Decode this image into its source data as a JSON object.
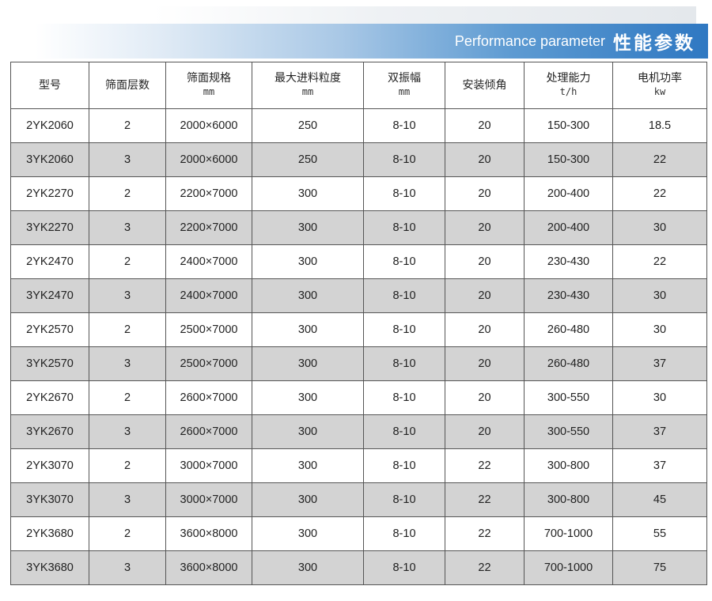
{
  "header": {
    "title_en": "Performance parameter",
    "title_cn": "性能参数"
  },
  "colors": {
    "banner_accent": "#2f78c2",
    "row_shade": "#d3d3d3",
    "border": "#555555"
  },
  "table": {
    "columns": [
      {
        "label": "型号",
        "unit": ""
      },
      {
        "label": "筛面层数",
        "unit": ""
      },
      {
        "label": "筛面规格",
        "unit": "mm"
      },
      {
        "label": "最大进料粒度",
        "unit": "mm"
      },
      {
        "label": "双振幅",
        "unit": "mm"
      },
      {
        "label": "安装倾角",
        "unit": ""
      },
      {
        "label": "处理能力",
        "unit": "t/h"
      },
      {
        "label": "电机功率",
        "unit": "kw"
      }
    ],
    "rows": [
      [
        "2YK2060",
        "2",
        "2000×6000",
        "250",
        "8-10",
        "20",
        "150-300",
        "18.5"
      ],
      [
        "3YK2060",
        "3",
        "2000×6000",
        "250",
        "8-10",
        "20",
        "150-300",
        "22"
      ],
      [
        "2YK2270",
        "2",
        "2200×7000",
        "300",
        "8-10",
        "20",
        "200-400",
        "22"
      ],
      [
        "3YK2270",
        "3",
        "2200×7000",
        "300",
        "8-10",
        "20",
        "200-400",
        "30"
      ],
      [
        "2YK2470",
        "2",
        "2400×7000",
        "300",
        "8-10",
        "20",
        "230-430",
        "22"
      ],
      [
        "3YK2470",
        "3",
        "2400×7000",
        "300",
        "8-10",
        "20",
        "230-430",
        "30"
      ],
      [
        "2YK2570",
        "2",
        "2500×7000",
        "300",
        "8-10",
        "20",
        "260-480",
        "30"
      ],
      [
        "3YK2570",
        "3",
        "2500×7000",
        "300",
        "8-10",
        "20",
        "260-480",
        "37"
      ],
      [
        "2YK2670",
        "2",
        "2600×7000",
        "300",
        "8-10",
        "20",
        "300-550",
        "30"
      ],
      [
        "3YK2670",
        "3",
        "2600×7000",
        "300",
        "8-10",
        "20",
        "300-550",
        "37"
      ],
      [
        "2YK3070",
        "2",
        "3000×7000",
        "300",
        "8-10",
        "22",
        "300-800",
        "37"
      ],
      [
        "3YK3070",
        "3",
        "3000×7000",
        "300",
        "8-10",
        "22",
        "300-800",
        "45"
      ],
      [
        "2YK3680",
        "2",
        "3600×8000",
        "300",
        "8-10",
        "22",
        "700-1000",
        "55"
      ],
      [
        "3YK3680",
        "3",
        "3600×8000",
        "300",
        "8-10",
        "22",
        "700-1000",
        "75"
      ]
    ]
  }
}
